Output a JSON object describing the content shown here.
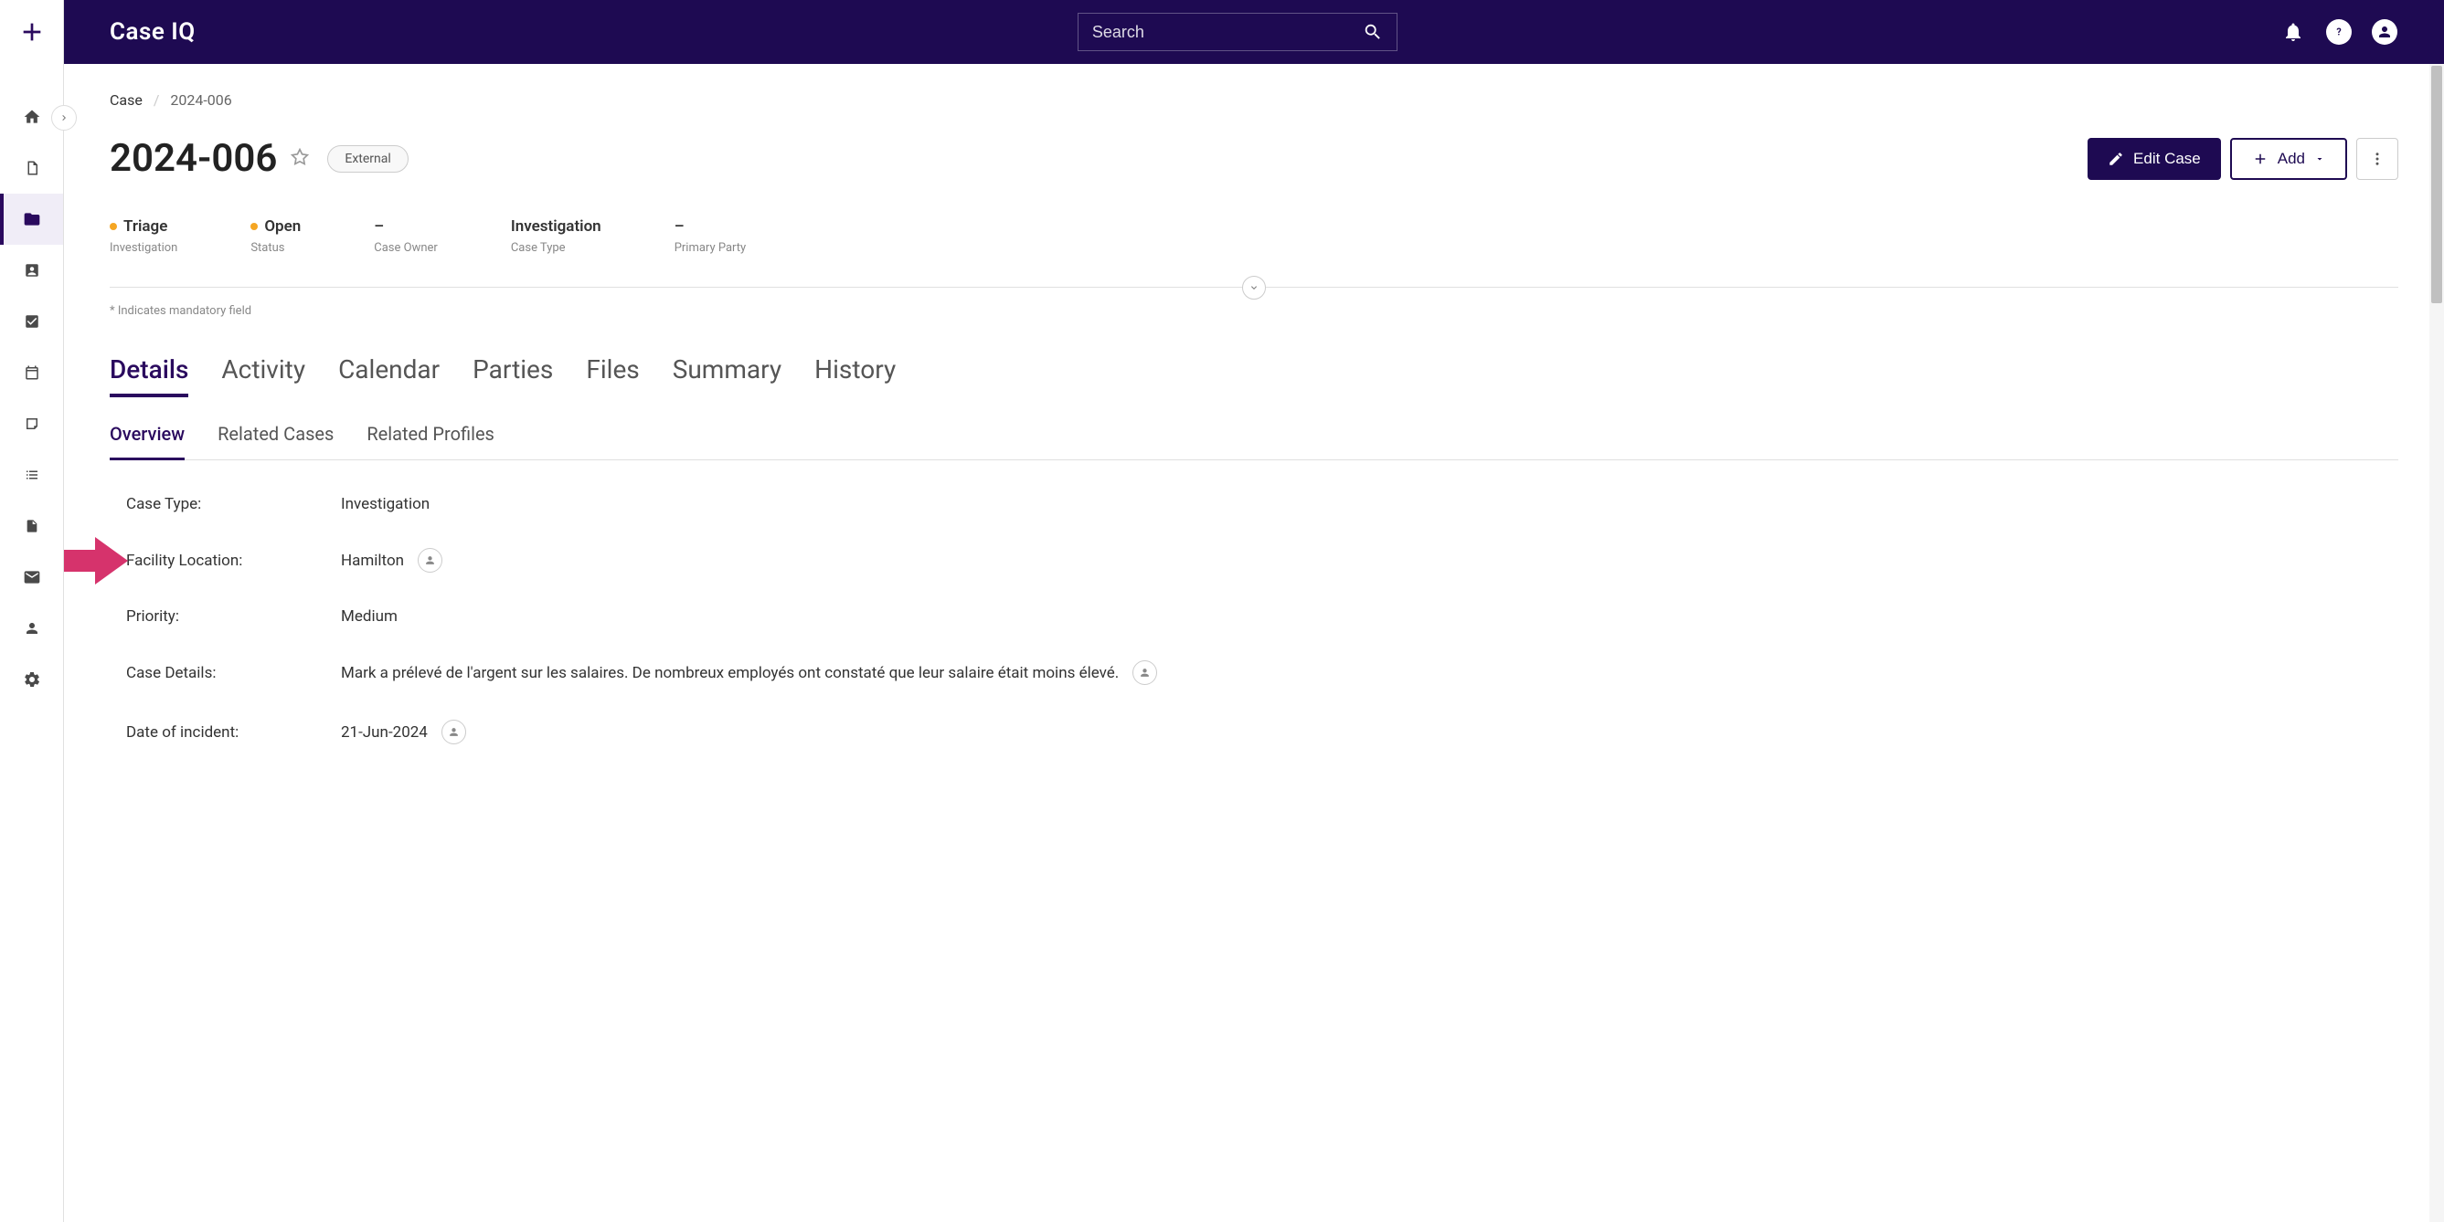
{
  "brand": "Case IQ",
  "search": {
    "placeholder": "Search"
  },
  "breadcrumb": {
    "root": "Case",
    "current": "2024-006"
  },
  "case": {
    "title": "2024-006",
    "badge": "External"
  },
  "buttons": {
    "edit": "Edit Case",
    "add": "Add"
  },
  "status": {
    "triage": {
      "value": "Triage",
      "label": "Investigation"
    },
    "open": {
      "value": "Open",
      "label": "Status"
    },
    "owner": {
      "value": "–",
      "label": "Case Owner"
    },
    "caseType": {
      "value": "Investigation",
      "label": "Case Type"
    },
    "party": {
      "value": "–",
      "label": "Primary Party"
    }
  },
  "mandatory_note": "* Indicates mandatory field",
  "tabs": [
    "Details",
    "Activity",
    "Calendar",
    "Parties",
    "Files",
    "Summary",
    "History"
  ],
  "sub_tabs": [
    "Overview",
    "Related Cases",
    "Related Profiles"
  ],
  "details": {
    "caseType": {
      "label": "Case Type:",
      "value": "Investigation"
    },
    "facility": {
      "label": "Facility Location:",
      "value": "Hamilton"
    },
    "priority": {
      "label": "Priority:",
      "value": "Medium"
    },
    "caseDetails": {
      "label": "Case Details:",
      "value": "Mark a prélevé de l'argent sur les salaires. De nombreux employés ont constaté que leur salaire était moins élevé."
    },
    "incidentDate": {
      "label": "Date of incident:",
      "value": "21-Jun-2024"
    }
  },
  "colors": {
    "brand": "#1e0a52",
    "accent": "#f5a623",
    "annotation": "#d6336c"
  }
}
